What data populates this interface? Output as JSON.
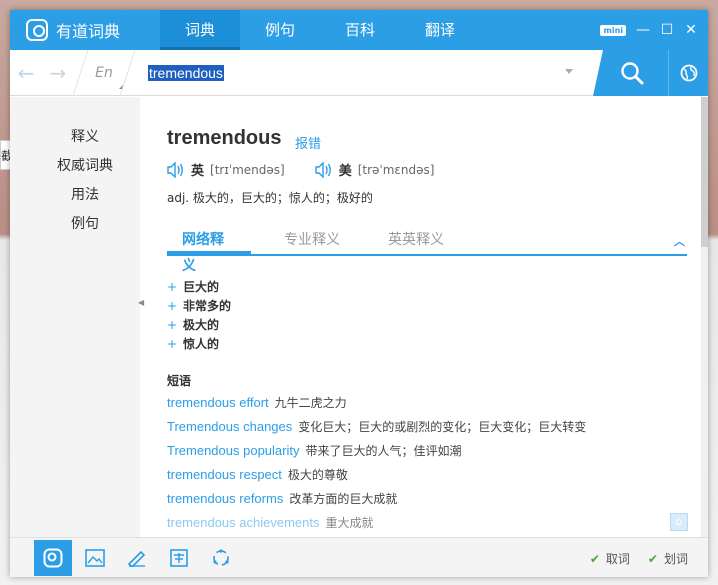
{
  "app": {
    "name": "有道词典"
  },
  "nav_tabs": [
    {
      "label": "词典",
      "active": true
    },
    {
      "label": "例句"
    },
    {
      "label": "百科"
    },
    {
      "label": "翻译"
    }
  ],
  "window_controls": {
    "mini_label": "mini",
    "minimize": "—",
    "maximize": "☐",
    "close": "✕"
  },
  "search": {
    "lang": "En",
    "query": "tremendous"
  },
  "sidebar": {
    "items": [
      {
        "label": "释义"
      },
      {
        "label": "权威词典"
      },
      {
        "label": "用法"
      },
      {
        "label": "例句"
      }
    ]
  },
  "entry": {
    "word": "tremendous",
    "report_label": "报错",
    "phonetics": [
      {
        "label": "英",
        "ipa": "[trɪˈmendəs]"
      },
      {
        "label": "美",
        "ipa": "[trəˈmɛndəs]"
      }
    ],
    "definition": "adj. 极大的，巨大的；惊人的；极好的"
  },
  "def_tabs": [
    {
      "label": "网络释义",
      "active": true
    },
    {
      "label": "专业释义"
    },
    {
      "label": "英英释义"
    }
  ],
  "web_meanings": [
    "巨大的",
    "非常多的",
    "极大的",
    "惊人的"
  ],
  "phrases_header": "短语",
  "phrases": [
    {
      "en": "tremendous effort",
      "cn": "九牛二虎之力"
    },
    {
      "en": "Tremendous changes",
      "cn": "变化巨大；巨大的或剧烈的变化；巨大变化；巨大转变"
    },
    {
      "en": "Tremendous popularity",
      "cn": "带来了巨大的人气；佳评如潮"
    },
    {
      "en": "tremendous respect",
      "cn": "极大的尊敬"
    },
    {
      "en": "tremendous reforms",
      "cn": "改革方面的巨大成就"
    },
    {
      "en": "tremendous achievements",
      "cn": "重大成就"
    }
  ],
  "bottom": {
    "cancel_label": "取词",
    "select_label": "划词"
  },
  "background": {
    "partial_text": "截"
  },
  "colors": {
    "accent": "#2b9ee6",
    "check": "#4aa82c"
  }
}
